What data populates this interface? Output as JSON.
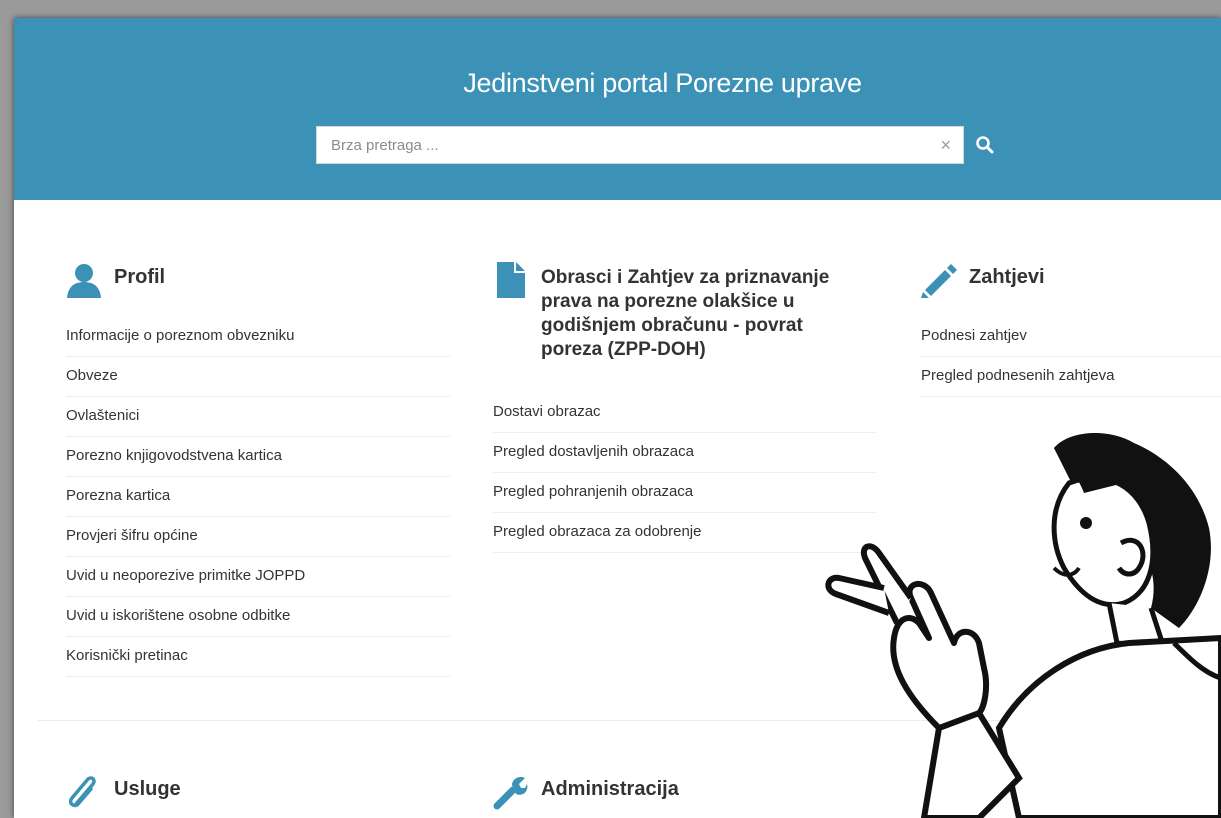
{
  "header": {
    "title": "Jedinstveni portal Porezne uprave",
    "search_placeholder": "Brza pretraga ...",
    "clear_label": "×"
  },
  "sections": {
    "profil": {
      "title": "Profil",
      "icon": "user-icon",
      "links": [
        "Informacije o poreznom obvezniku",
        "Obveze",
        "Ovlaštenici",
        "Porezno knjigovodstvena kartica",
        "Porezna kartica",
        "Provjeri šifru općine",
        "Uvid u neoporezive primitke JOPPD",
        "Uvid u iskorištene osobne odbitke",
        "Korisnički pretinac"
      ]
    },
    "obrasci": {
      "title_lines": [
        "Obrasci i Zahtjev za priznavanje",
        "prava na porezne olakšice u",
        "godišnjem obračunu - povrat",
        "poreza (ZPP-DOH)"
      ],
      "icon": "document-icon",
      "links": [
        "Dostavi obrazac",
        "Pregled dostavljenih obrazaca",
        "Pregled pohranjenih obrazaca",
        "Pregled obrazaca za odobrenje"
      ]
    },
    "zahtjevi": {
      "title": "Zahtjevi",
      "icon": "pencil-icon",
      "links": [
        "Podnesi zahtjev",
        "Pregled podnesenih zahtjeva"
      ]
    },
    "usluge": {
      "title": "Usluge",
      "icon": "paperclip-icon"
    },
    "administracija": {
      "title": "Administracija",
      "icon": "wrench-icon"
    }
  },
  "colors": {
    "header_bg": "#3b91b6",
    "icon_accent": "#3b91b6",
    "text": "#333333"
  }
}
